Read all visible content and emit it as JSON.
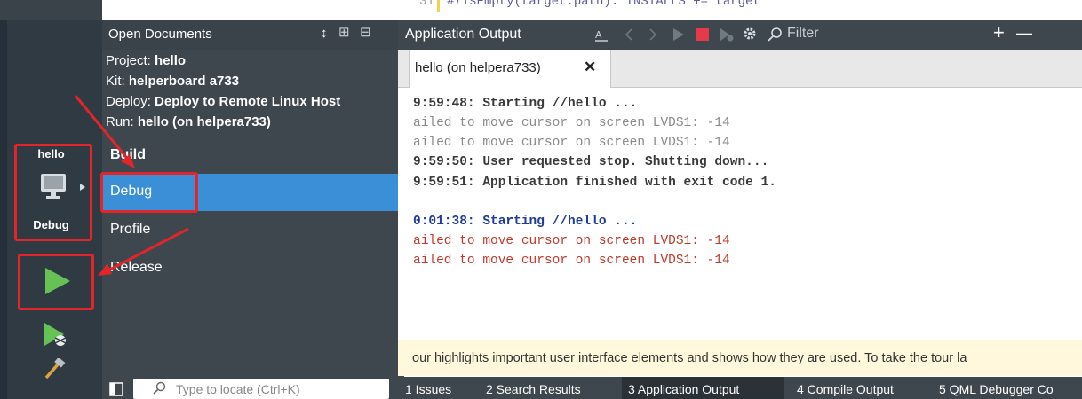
{
  "code_line": "#!isEmpty(target.path): INSTALLS += target",
  "code_line_no": "31",
  "open_documents": {
    "title": "Open Documents",
    "sort_glyph": "↕",
    "split_glyph": "⊞",
    "close_glyph": "⊟"
  },
  "target": {
    "project_label": "Project: ",
    "project_value": "hello",
    "kit_label": "Kit: ",
    "kit_value": "helperboard a733",
    "deploy_label": "Deploy: ",
    "deploy_value": "Deploy to Remote Linux Host",
    "run_label": "Run: ",
    "run_value": "hello (on helpera733)"
  },
  "build_menu": {
    "items": [
      "Build",
      "Debug",
      "Profile",
      "Release"
    ],
    "selected": "Debug"
  },
  "modebar": {
    "project_name": "hello",
    "build_config": "Debug",
    "device_icon": "monitor-icon",
    "run_icon": "run-icon",
    "debug_run_icon": "debug-run-icon",
    "build_icon": "hammer-icon"
  },
  "output_pane": {
    "title": "Application Output",
    "filter_placeholder": "Filter",
    "add_glyph": "+",
    "minus_glyph": "—",
    "tab_label": "hello (on helpera733)",
    "tab_close": "✕"
  },
  "log": [
    {
      "text": "9:59:48: Starting //hello ...",
      "kind": "info"
    },
    {
      "text": "ailed to move cursor on screen LVDS1: -14",
      "kind": "gray"
    },
    {
      "text": "ailed to move cursor on screen LVDS1: -14",
      "kind": "gray"
    },
    {
      "text": "9:59:50: User requested stop. Shutting down...",
      "kind": "info"
    },
    {
      "text": "9:59:51: Application finished with exit code 1.",
      "kind": "info"
    },
    {
      "text": "0:01:38: Starting //hello ...",
      "kind": "start"
    },
    {
      "text": "ailed to move cursor on screen LVDS1: -14",
      "kind": "error"
    },
    {
      "text": "ailed to move cursor on screen LVDS1: -14",
      "kind": "error"
    }
  ],
  "tour_text": "our highlights important user interface elements and shows how they are used. To take the tour la",
  "locator": {
    "placeholder": "Type to locate (Ctrl+K)"
  },
  "bottom_tabs": [
    "1  Issues",
    "2  Search Results",
    "3  Application Output",
    "4  Compile Output",
    "5  QML Debugger Co"
  ],
  "colors": {
    "accent_blue": "#3b8fd6",
    "highlight_red": "#e1252b",
    "run_green": "#66c256",
    "stop_red": "#e8394b",
    "log_info": "#3a3a3a",
    "log_gray": "#8a8a8a",
    "log_start": "#1d3b9c",
    "log_error": "#c0392b"
  }
}
